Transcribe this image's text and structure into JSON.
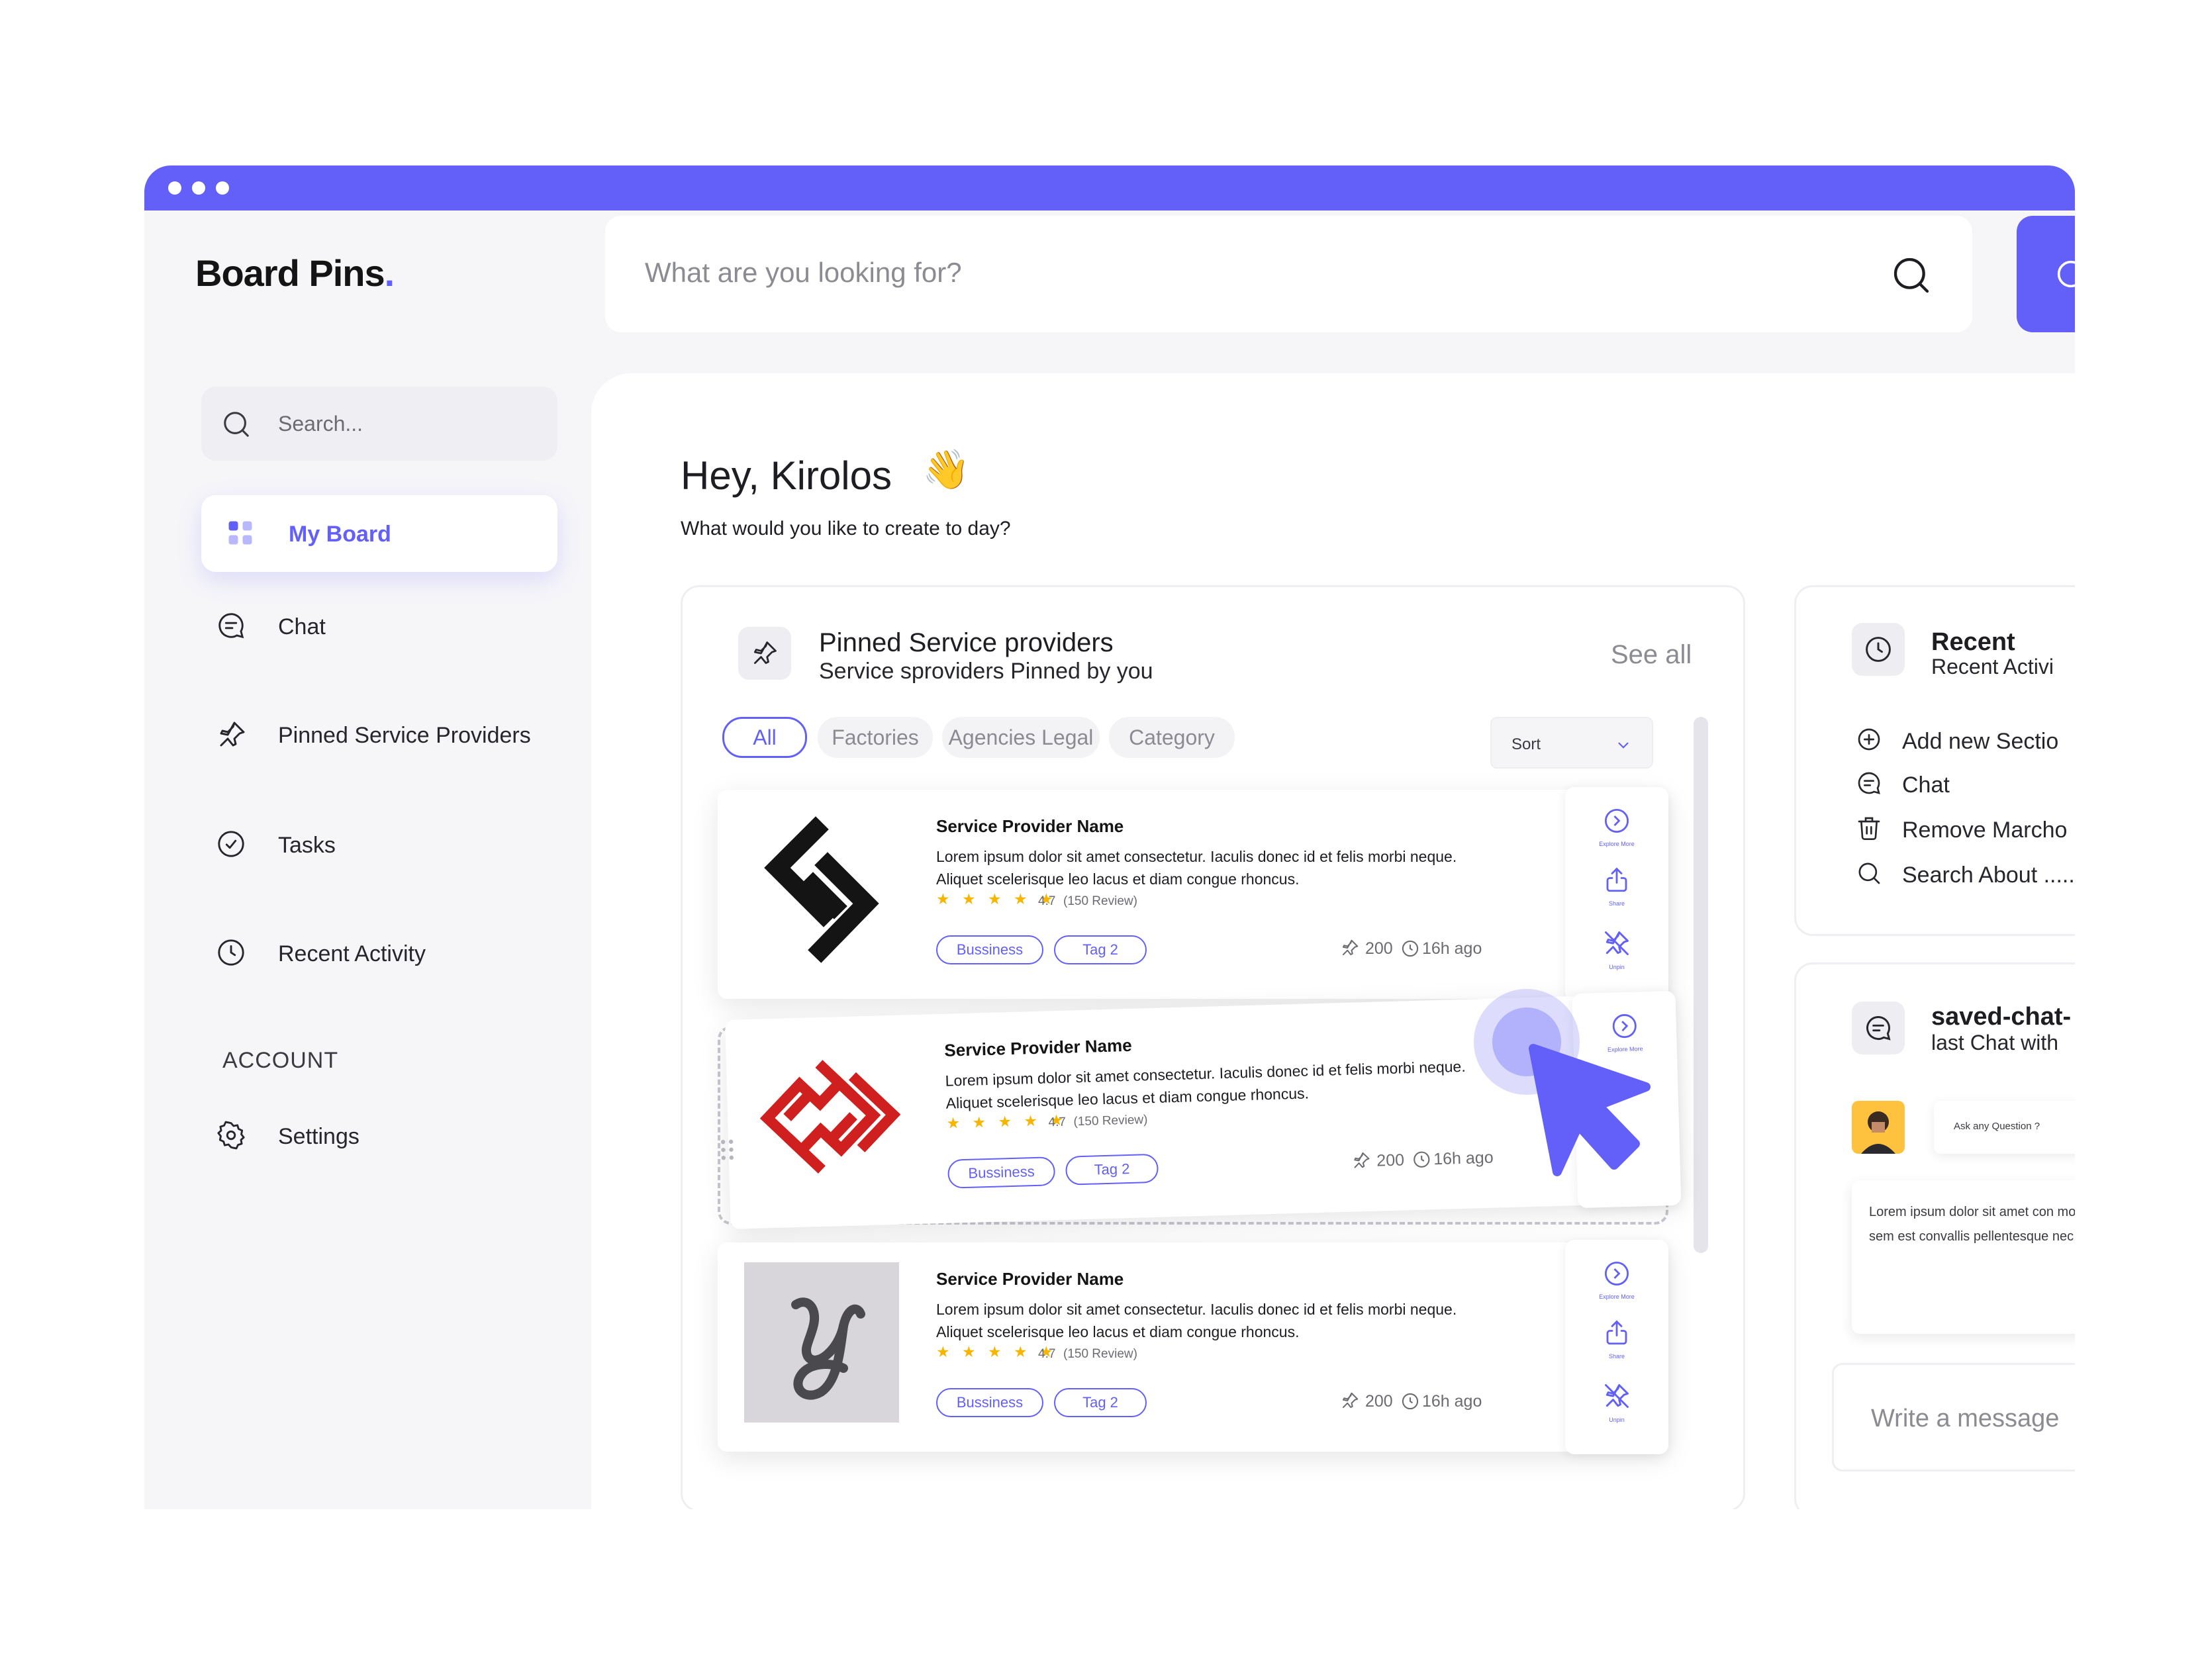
{
  "app": {
    "logo": "Board Pins",
    "logo_dot": "."
  },
  "top_search": {
    "placeholder": "What are you looking for?"
  },
  "sidebar": {
    "search_placeholder": "Search...",
    "active_item": "My Board",
    "items": [
      "Chat",
      "Pinned Service Providers",
      "Tasks",
      "Recent Activity"
    ],
    "section_label": "ACCOUNT",
    "settings_label": "Settings"
  },
  "main": {
    "greeting": "Hey, Kirolos",
    "wave": "👋",
    "subtitle": "What would you like to create to day?"
  },
  "pinned": {
    "title": "Pinned Service providers",
    "subtitle": "Service sproviders Pinned by you",
    "see_all": "See all",
    "filters": [
      "All",
      "Factories",
      "Agencies Legal",
      "Category"
    ],
    "sort_label": "Sort",
    "providers": [
      {
        "name": "Service Provider Name",
        "description": "Lorem ipsum dolor sit amet consectetur. Iaculis donec id et felis morbi neque. Aliquet scelerisque leo lacus et diam congue rhoncus.",
        "stars": "★ ★ ★ ★ ★",
        "rating": "4.7",
        "reviews": "(150 Review)",
        "tags": [
          "Bussiness",
          "Tag 2"
        ],
        "pins": "200",
        "time": "16h ago"
      },
      {
        "name": "Service Provider Name",
        "description": "Lorem ipsum dolor sit amet consectetur. Iaculis donec id et felis morbi neque. Aliquet scelerisque leo lacus et diam congue rhoncus.",
        "stars": "★ ★ ★ ★ ★",
        "rating": "4.7",
        "reviews": "(150 Review)",
        "tags": [
          "Bussiness",
          "Tag 2"
        ],
        "pins": "200",
        "time": "16h ago"
      },
      {
        "name": "Service Provider Name",
        "description": "Lorem ipsum dolor sit amet consectetur. Iaculis donec id et felis morbi neque. Aliquet scelerisque leo lacus et diam congue rhoncus.",
        "stars": "★ ★ ★ ★ ★",
        "rating": "4.7",
        "reviews": "(150 Review)",
        "tags": [
          "Bussiness",
          "Tag 2"
        ],
        "pins": "200",
        "time": "16h ago"
      }
    ],
    "actions": [
      "Explore More",
      "Share",
      "Unpin"
    ]
  },
  "recent": {
    "title": "Recent",
    "subtitle": "Recent Activi",
    "items": [
      "Add new Sectio",
      "Chat",
      "Remove Marcho",
      "Search About ....."
    ]
  },
  "chat": {
    "title": "saved-chat-",
    "subtitle": "last Chat with",
    "question": "Ask any Question ?",
    "message": "Lorem ipsum dolor sit amet con molestie diam nisi sed sem est convallis pellentesque nec. Est proin leo.",
    "write_placeholder": "Write a message"
  },
  "colors": {
    "accent": "#6260f8",
    "star": "#f7b500",
    "panel_bg": "#f6f6f9"
  }
}
